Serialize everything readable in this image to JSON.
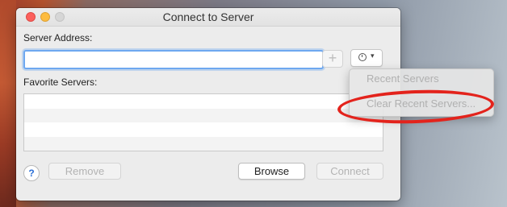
{
  "window": {
    "title": "Connect to Server"
  },
  "labels": {
    "server_address": "Server Address:",
    "favorite_servers": "Favorite Servers:"
  },
  "server_input": {
    "value": "",
    "placeholder": ""
  },
  "buttons": {
    "add": "+",
    "help": "?",
    "remove": "Remove",
    "browse": "Browse",
    "connect": "Connect"
  },
  "recent_menu": {
    "items": [
      "Recent Servers",
      "Clear Recent Servers..."
    ]
  },
  "favorite_servers": {
    "rows": [
      "",
      "",
      "",
      ""
    ]
  },
  "colors": {
    "highlight": "#e3231c",
    "focus_ring": "#6ea8f0",
    "help_accent": "#2b6fd6"
  },
  "icons": {
    "close": "close-icon",
    "minimize": "minimize-icon",
    "zoom": "zoom-icon",
    "action": "clock-icon",
    "chevron": "chevron-down-icon"
  }
}
